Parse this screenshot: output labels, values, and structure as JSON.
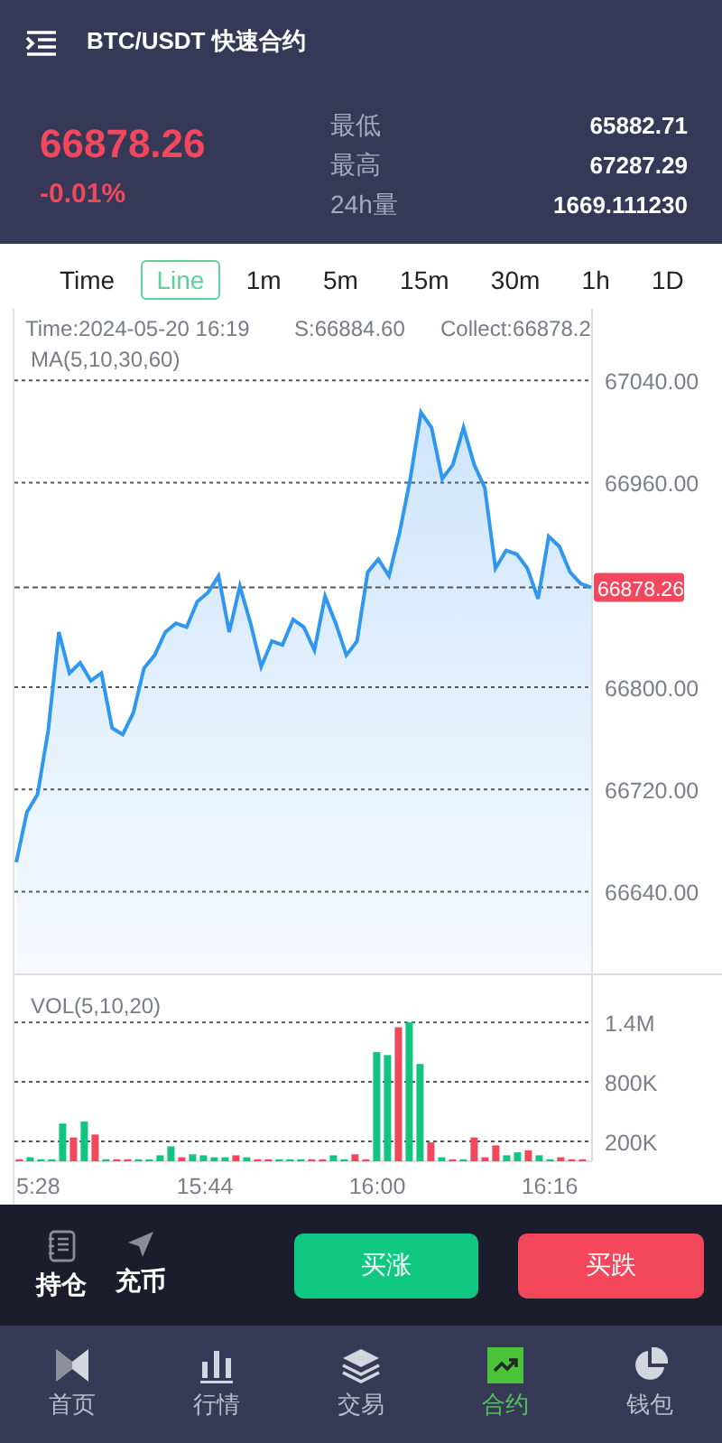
{
  "header": {
    "title": "BTC/USDT 快速合约"
  },
  "ticker": {
    "price": "66878.26",
    "change": "-0.01%",
    "stats": [
      {
        "label": "最低",
        "value": "65882.71"
      },
      {
        "label": "最高",
        "value": "67287.29"
      },
      {
        "label": "24h量",
        "value": "1669.111230"
      }
    ]
  },
  "intervals": [
    {
      "label": "Time",
      "selected": false
    },
    {
      "label": "Line",
      "selected": true
    },
    {
      "label": "1m",
      "selected": false
    },
    {
      "label": "5m",
      "selected": false
    },
    {
      "label": "15m",
      "selected": false
    },
    {
      "label": "30m",
      "selected": false
    },
    {
      "label": "1h",
      "selected": false
    },
    {
      "label": "1D",
      "selected": false
    }
  ],
  "chart": {
    "info": [
      "Time:2024-05-20 16:19",
      "S:66884.60",
      "Collect:66878.2"
    ],
    "price_tag": "66878.26",
    "chart_data": {
      "type": "area",
      "title": "MA(5,10,30,60)",
      "color": "#2f97f0",
      "grid": true,
      "ylim": [
        66576,
        67096
      ],
      "values": [
        66663,
        66702,
        66716,
        66766,
        66843,
        66811,
        66819,
        66805,
        66811,
        66768,
        66763,
        66780,
        66815,
        66825,
        66843,
        66850,
        66847,
        66867,
        66874,
        66887,
        66843,
        66879,
        66850,
        66816,
        66836,
        66833,
        66853,
        66847,
        66829,
        66871,
        66850,
        66825,
        66836,
        66890,
        66900,
        66887,
        66921,
        66963,
        67015,
        67003,
        66963,
        66974,
        67003,
        66974,
        66956,
        66893,
        66907,
        66904,
        66893,
        66869,
        66918,
        66910,
        66890,
        66881,
        66878
      ],
      "yticks": [
        {
          "value": 67040,
          "label": "67040.00"
        },
        {
          "value": 66960,
          "label": "66960.00"
        },
        {
          "value": 66800,
          "label": "66800.00"
        },
        {
          "value": 66720,
          "label": "66720.00"
        },
        {
          "value": 66640,
          "label": "66640.00"
        }
      ]
    }
  },
  "volume": {
    "chart_data": {
      "type": "bar",
      "title": "VOL(5,10,20)",
      "grid": true,
      "ylim": [
        0,
        1820000
      ],
      "series": [
        {
          "color": "#12c57f",
          "values": [
            null,
            40000,
            20000,
            20000,
            380000,
            null,
            400000,
            null,
            20000,
            null,
            null,
            20000,
            20000,
            60000,
            150000,
            null,
            70000,
            60000,
            40000,
            40000,
            null,
            40000,
            null,
            null,
            20000,
            20000,
            20000,
            null,
            null,
            60000,
            20000,
            null,
            null,
            1100000,
            1070000,
            null,
            1400000,
            980000,
            null,
            40000,
            null,
            20000,
            null,
            null,
            null,
            60000,
            90000,
            null,
            60000,
            20000,
            null,
            null,
            null
          ]
        },
        {
          "color": "#f2475d",
          "values": [
            20000,
            null,
            null,
            null,
            null,
            240000,
            null,
            270000,
            null,
            20000,
            20000,
            null,
            null,
            null,
            null,
            40000,
            null,
            null,
            null,
            null,
            60000,
            null,
            20000,
            20000,
            null,
            null,
            null,
            20000,
            20000,
            null,
            null,
            70000,
            20000,
            null,
            null,
            1350000,
            null,
            null,
            190000,
            null,
            20000,
            null,
            240000,
            40000,
            160000,
            null,
            null,
            110000,
            null,
            null,
            40000,
            20000,
            20000
          ]
        }
      ],
      "yticks": [
        {
          "value": 1400000,
          "label": "1.4M"
        },
        {
          "value": 800000,
          "label": "800K"
        },
        {
          "value": 200000,
          "label": "200K"
        }
      ]
    },
    "time_labels": [
      "5:28",
      "15:44",
      "16:00",
      "16:16"
    ]
  },
  "actions": {
    "links": [
      "持仓",
      "充币"
    ],
    "buy_up": "买涨",
    "buy_down": "买跌"
  },
  "nav": [
    {
      "label": "首页",
      "selected": false
    },
    {
      "label": "行情",
      "selected": false
    },
    {
      "label": "交易",
      "selected": false
    },
    {
      "label": "合约",
      "selected": true
    },
    {
      "label": "钱包",
      "selected": false
    }
  ]
}
